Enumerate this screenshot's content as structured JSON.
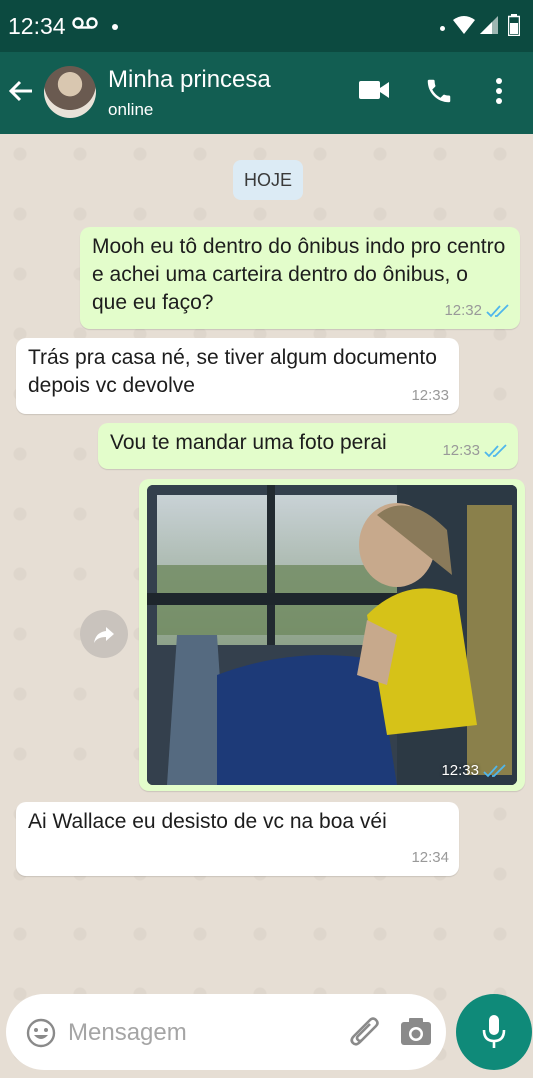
{
  "status_bar": {
    "time": "12:34"
  },
  "contact": {
    "name": "Minha princesa",
    "status": "online"
  },
  "date_chip": "HOJE",
  "messages": [
    {
      "direction": "out",
      "text": "Mooh eu tô dentro do ônibus indo pro centro e achei uma carteira dentro do ônibus, o que eu faço?",
      "time": "12:32",
      "read": true
    },
    {
      "direction": "in",
      "text": "Trás pra casa né, se tiver algum documento depois vc devolve",
      "time": "12:33"
    },
    {
      "direction": "out",
      "text": "Vou te mandar uma foto perai",
      "time": "12:33",
      "read": true
    },
    {
      "direction": "out",
      "type": "image",
      "time": "12:33",
      "read": true
    },
    {
      "direction": "in",
      "text": "Ai Wallace eu desisto de vc na boa véi",
      "time": "12:34"
    }
  ],
  "input": {
    "placeholder": "Mensagem"
  },
  "colors": {
    "header": "#125e52",
    "status_bar": "#0c4a40",
    "outgoing_bubble": "#e3fdcb",
    "incoming_bubble": "#ffffff",
    "mic_button": "#0f8a79",
    "read_ticks": "#4fb6ec"
  },
  "icons": [
    "voicemail-icon",
    "wifi-icon",
    "signal-icon",
    "battery-icon",
    "back-arrow-icon",
    "video-call-icon",
    "phone-icon",
    "more-menu-icon",
    "double-check-icon",
    "forward-icon",
    "emoji-icon",
    "attach-icon",
    "camera-icon",
    "mic-icon"
  ]
}
